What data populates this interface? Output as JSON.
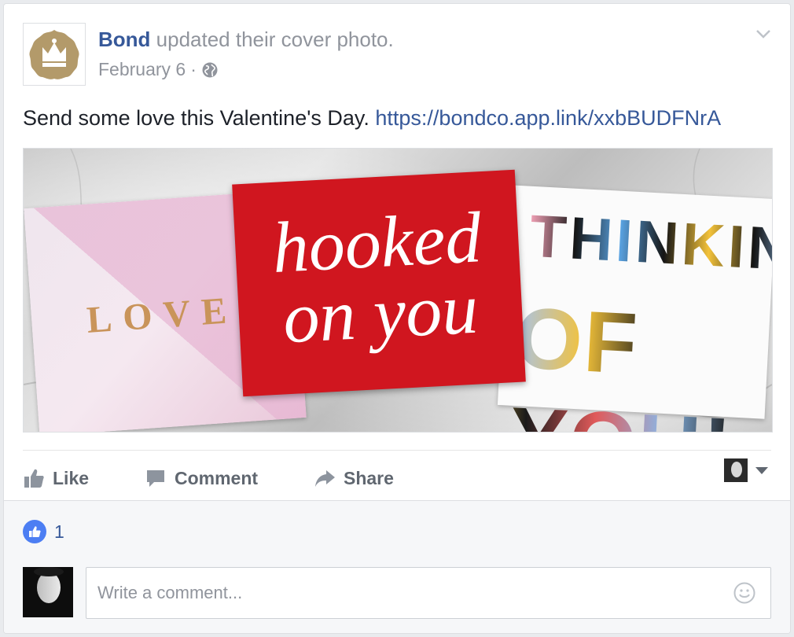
{
  "post": {
    "page_name": "Bond",
    "action_text": " updated their cover photo.",
    "date": "February 6",
    "separator": " ·",
    "body_text": "Send some love this Valentine's Day. ",
    "body_link": "https://bondco.app.link/xxbBUDFNrA"
  },
  "cover_image": {
    "card1_text": "LOVE",
    "card2_line1": "hooked",
    "card2_line2": "on you",
    "card3_line1": "THINKING",
    "card3_line2": "OF YOU!"
  },
  "actions": {
    "like_label": "Like",
    "comment_label": "Comment",
    "share_label": "Share"
  },
  "reactions": {
    "count": "1"
  },
  "comment": {
    "placeholder": "Write a comment..."
  },
  "colors": {
    "link_blue": "#365899",
    "like_blue": "#4c7ef3",
    "muted_gray": "#90949c",
    "action_gray": "#606770"
  },
  "icons": {
    "page_logo": "crown-logo",
    "privacy": "globe-icon",
    "menu": "chevron-down-icon",
    "like": "thumbs-up-icon",
    "comment": "speech-bubble-icon",
    "share": "share-arrow-icon",
    "audience_caret": "caret-down-icon",
    "reaction": "like-reaction-icon",
    "emoji": "smiley-icon"
  }
}
